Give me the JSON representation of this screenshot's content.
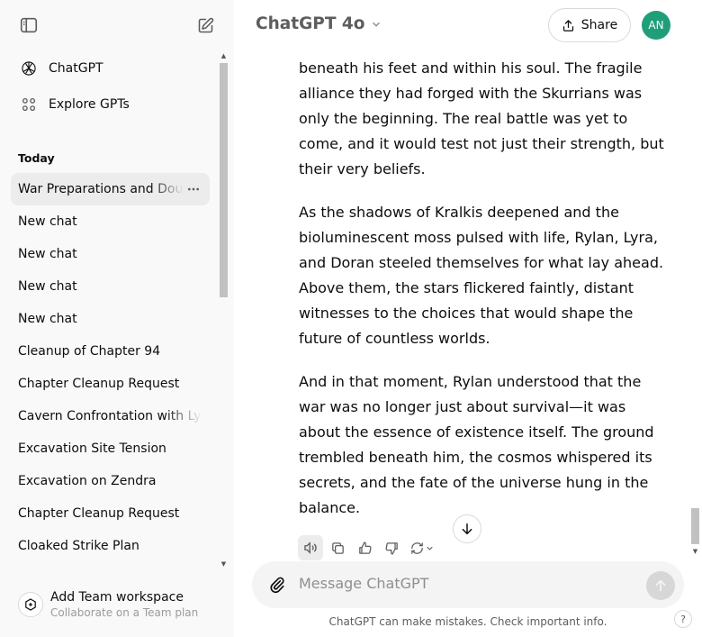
{
  "sidebar": {
    "nav": [
      {
        "label": "ChatGPT",
        "icon": "openai-logo-icon"
      },
      {
        "label": "Explore GPTs",
        "icon": "grid-icon"
      }
    ],
    "section_today": "Today",
    "chats": [
      {
        "label": "War Preparations and Doubts",
        "active": true
      },
      {
        "label": "New chat"
      },
      {
        "label": "New chat"
      },
      {
        "label": "New chat"
      },
      {
        "label": "New chat"
      },
      {
        "label": "Cleanup of Chapter 94"
      },
      {
        "label": "Chapter Cleanup Request"
      },
      {
        "label": "Cavern Confrontation with Lyra"
      },
      {
        "label": "Excavation Site Tension"
      },
      {
        "label": "Excavation on Zendra"
      },
      {
        "label": "Chapter Cleanup Request"
      },
      {
        "label": "Cloaked Strike Plan"
      }
    ],
    "team": {
      "title": "Add Team workspace",
      "subtitle": "Collaborate on a Team plan"
    }
  },
  "header": {
    "model": "ChatGPT 4o",
    "share": "Share",
    "avatar": "AN"
  },
  "message": {
    "partial_line": "beneath his feet and within his soul.",
    "paragraphs": [
      "beneath his feet and within his soul. The fragile alliance they had forged with the Skurrians was only the beginning. The real battle was yet to come, and it would test not just their strength, but their very beliefs.",
      "As the shadows of Kralkis deepened and the bioluminescent moss pulsed with life, Rylan, Lyra, and Doran steeled themselves for what lay ahead. Above them, the stars flickered faintly, distant witnesses to the choices that would shape the future of countless worlds.",
      "And in that moment, Rylan understood that the war was no longer just about survival—it was about the essence of existence itself. The ground trembled beneath him, the cosmos whispered its secrets, and the fate of the universe hung in the balance."
    ]
  },
  "composer": {
    "placeholder": "Message ChatGPT",
    "disclaimer": "ChatGPT can make mistakes. Check important info.",
    "help": "?"
  },
  "colors": {
    "sidebar_bg": "#f9f9f9",
    "active_chat_bg": "#ececec",
    "avatar_bg": "#1f9e7a",
    "composer_bg": "#f4f4f4"
  }
}
